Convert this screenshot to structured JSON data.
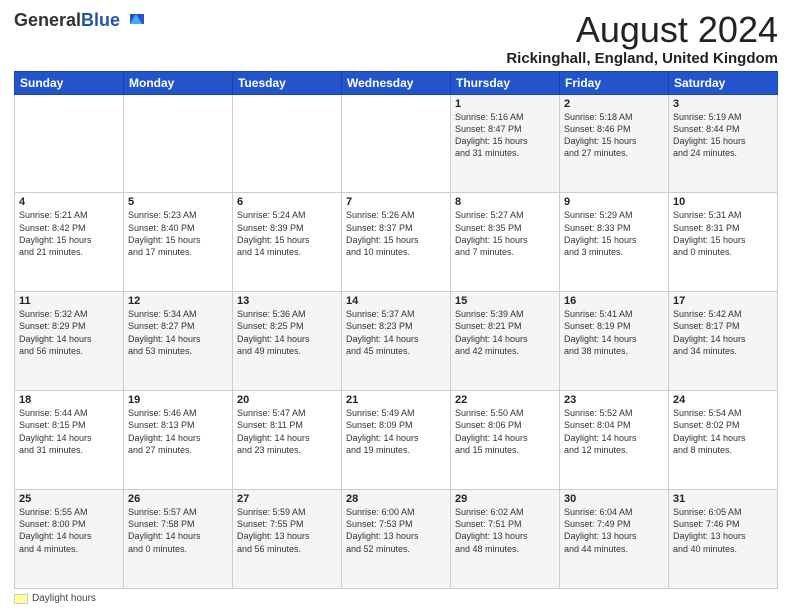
{
  "header": {
    "logo_general": "General",
    "logo_blue": "Blue",
    "month_title": "August 2024",
    "location": "Rickinghall, England, United Kingdom"
  },
  "footer": {
    "legend_label": "Daylight hours"
  },
  "calendar": {
    "days_of_week": [
      "Sunday",
      "Monday",
      "Tuesday",
      "Wednesday",
      "Thursday",
      "Friday",
      "Saturday"
    ],
    "weeks": [
      [
        {
          "day": "",
          "info": ""
        },
        {
          "day": "",
          "info": ""
        },
        {
          "day": "",
          "info": ""
        },
        {
          "day": "",
          "info": ""
        },
        {
          "day": "1",
          "info": "Sunrise: 5:16 AM\nSunset: 8:47 PM\nDaylight: 15 hours\nand 31 minutes."
        },
        {
          "day": "2",
          "info": "Sunrise: 5:18 AM\nSunset: 8:46 PM\nDaylight: 15 hours\nand 27 minutes."
        },
        {
          "day": "3",
          "info": "Sunrise: 5:19 AM\nSunset: 8:44 PM\nDaylight: 15 hours\nand 24 minutes."
        }
      ],
      [
        {
          "day": "4",
          "info": "Sunrise: 5:21 AM\nSunset: 8:42 PM\nDaylight: 15 hours\nand 21 minutes."
        },
        {
          "day": "5",
          "info": "Sunrise: 5:23 AM\nSunset: 8:40 PM\nDaylight: 15 hours\nand 17 minutes."
        },
        {
          "day": "6",
          "info": "Sunrise: 5:24 AM\nSunset: 8:39 PM\nDaylight: 15 hours\nand 14 minutes."
        },
        {
          "day": "7",
          "info": "Sunrise: 5:26 AM\nSunset: 8:37 PM\nDaylight: 15 hours\nand 10 minutes."
        },
        {
          "day": "8",
          "info": "Sunrise: 5:27 AM\nSunset: 8:35 PM\nDaylight: 15 hours\nand 7 minutes."
        },
        {
          "day": "9",
          "info": "Sunrise: 5:29 AM\nSunset: 8:33 PM\nDaylight: 15 hours\nand 3 minutes."
        },
        {
          "day": "10",
          "info": "Sunrise: 5:31 AM\nSunset: 8:31 PM\nDaylight: 15 hours\nand 0 minutes."
        }
      ],
      [
        {
          "day": "11",
          "info": "Sunrise: 5:32 AM\nSunset: 8:29 PM\nDaylight: 14 hours\nand 56 minutes."
        },
        {
          "day": "12",
          "info": "Sunrise: 5:34 AM\nSunset: 8:27 PM\nDaylight: 14 hours\nand 53 minutes."
        },
        {
          "day": "13",
          "info": "Sunrise: 5:36 AM\nSunset: 8:25 PM\nDaylight: 14 hours\nand 49 minutes."
        },
        {
          "day": "14",
          "info": "Sunrise: 5:37 AM\nSunset: 8:23 PM\nDaylight: 14 hours\nand 45 minutes."
        },
        {
          "day": "15",
          "info": "Sunrise: 5:39 AM\nSunset: 8:21 PM\nDaylight: 14 hours\nand 42 minutes."
        },
        {
          "day": "16",
          "info": "Sunrise: 5:41 AM\nSunset: 8:19 PM\nDaylight: 14 hours\nand 38 minutes."
        },
        {
          "day": "17",
          "info": "Sunrise: 5:42 AM\nSunset: 8:17 PM\nDaylight: 14 hours\nand 34 minutes."
        }
      ],
      [
        {
          "day": "18",
          "info": "Sunrise: 5:44 AM\nSunset: 8:15 PM\nDaylight: 14 hours\nand 31 minutes."
        },
        {
          "day": "19",
          "info": "Sunrise: 5:46 AM\nSunset: 8:13 PM\nDaylight: 14 hours\nand 27 minutes."
        },
        {
          "day": "20",
          "info": "Sunrise: 5:47 AM\nSunset: 8:11 PM\nDaylight: 14 hours\nand 23 minutes."
        },
        {
          "day": "21",
          "info": "Sunrise: 5:49 AM\nSunset: 8:09 PM\nDaylight: 14 hours\nand 19 minutes."
        },
        {
          "day": "22",
          "info": "Sunrise: 5:50 AM\nSunset: 8:06 PM\nDaylight: 14 hours\nand 15 minutes."
        },
        {
          "day": "23",
          "info": "Sunrise: 5:52 AM\nSunset: 8:04 PM\nDaylight: 14 hours\nand 12 minutes."
        },
        {
          "day": "24",
          "info": "Sunrise: 5:54 AM\nSunset: 8:02 PM\nDaylight: 14 hours\nand 8 minutes."
        }
      ],
      [
        {
          "day": "25",
          "info": "Sunrise: 5:55 AM\nSunset: 8:00 PM\nDaylight: 14 hours\nand 4 minutes."
        },
        {
          "day": "26",
          "info": "Sunrise: 5:57 AM\nSunset: 7:58 PM\nDaylight: 14 hours\nand 0 minutes."
        },
        {
          "day": "27",
          "info": "Sunrise: 5:59 AM\nSunset: 7:55 PM\nDaylight: 13 hours\nand 56 minutes."
        },
        {
          "day": "28",
          "info": "Sunrise: 6:00 AM\nSunset: 7:53 PM\nDaylight: 13 hours\nand 52 minutes."
        },
        {
          "day": "29",
          "info": "Sunrise: 6:02 AM\nSunset: 7:51 PM\nDaylight: 13 hours\nand 48 minutes."
        },
        {
          "day": "30",
          "info": "Sunrise: 6:04 AM\nSunset: 7:49 PM\nDaylight: 13 hours\nand 44 minutes."
        },
        {
          "day": "31",
          "info": "Sunrise: 6:05 AM\nSunset: 7:46 PM\nDaylight: 13 hours\nand 40 minutes."
        }
      ]
    ]
  }
}
